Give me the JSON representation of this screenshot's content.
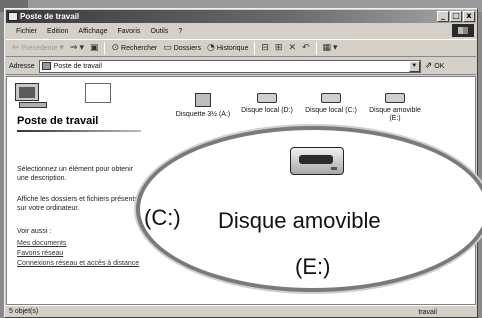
{
  "window": {
    "title": "Poste de travail",
    "controls": [
      "_",
      "□",
      "x"
    ]
  },
  "menubar": {
    "items": [
      "Fichier",
      "Edition",
      "Affichage",
      "Favoris",
      "Outils",
      "?"
    ]
  },
  "toolbar": {
    "back": "Précédente",
    "search": "Rechercher",
    "folders": "Dossiers",
    "history": "Historique"
  },
  "addressbar": {
    "label": "Adresse",
    "value": "Poste de travail",
    "go": "OK"
  },
  "left_panel": {
    "title": "Poste de travail",
    "select_hint": "Sélectionnez un élément pour obtenir une description.",
    "show_hint": "Affiche les dossiers et fichiers présents sur votre ordinateur.",
    "see_also": "Voir aussi :",
    "links": [
      "Mes documents",
      "Favoris réseau",
      "Connexions réseau et accès à distance"
    ]
  },
  "drives": {
    "floppy": "Disquette 3½ (A:)",
    "disk_d": "Disque local (D:)",
    "disk_c": "Disque local (C:)",
    "removable": "Disque amovible (E:)"
  },
  "magnifier": {
    "left_fragment": "(C:)",
    "label": "Disque amovible",
    "letter": "(E:)"
  },
  "statusbar": {
    "left": "5 objet(s)",
    "right": "travail"
  }
}
